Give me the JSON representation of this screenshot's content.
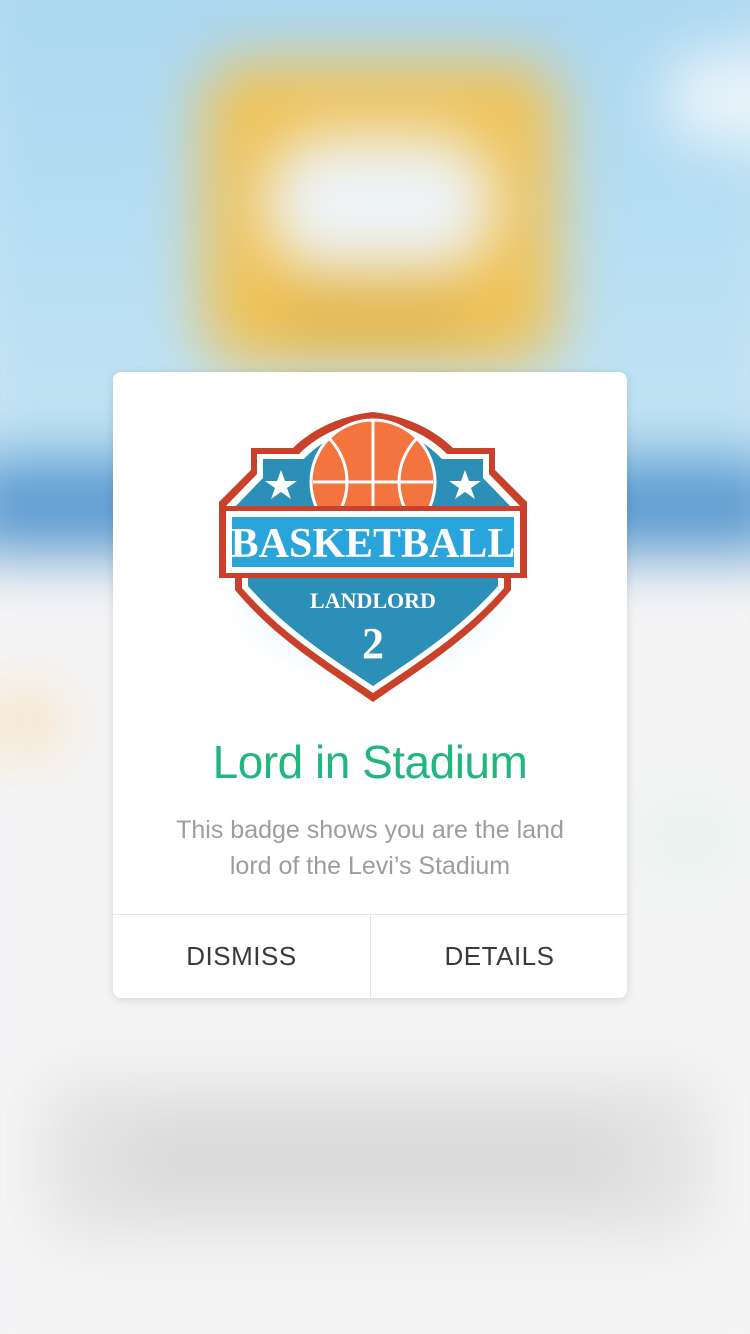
{
  "dialog": {
    "badge": {
      "banner_text": "BASKETBALL",
      "rank_label": "LANDLORD",
      "rank_number": "2",
      "icon": "basketball-icon",
      "colors": {
        "shield_blue": "#2b8fb8",
        "shield_border": "#c9412a",
        "banner_blue": "#2aa5dc",
        "ball_orange": "#f4743f",
        "star": "#ffffff"
      }
    },
    "title": "Lord in Stadium",
    "description": "This badge shows you are the land lord of the Levi’s Stadium",
    "buttons": {
      "dismiss": "DISMISS",
      "details": "DETAILS"
    },
    "colors": {
      "title": "#22b67f",
      "description": "#9d9d9f",
      "button_text": "#3a3a3c"
    }
  }
}
